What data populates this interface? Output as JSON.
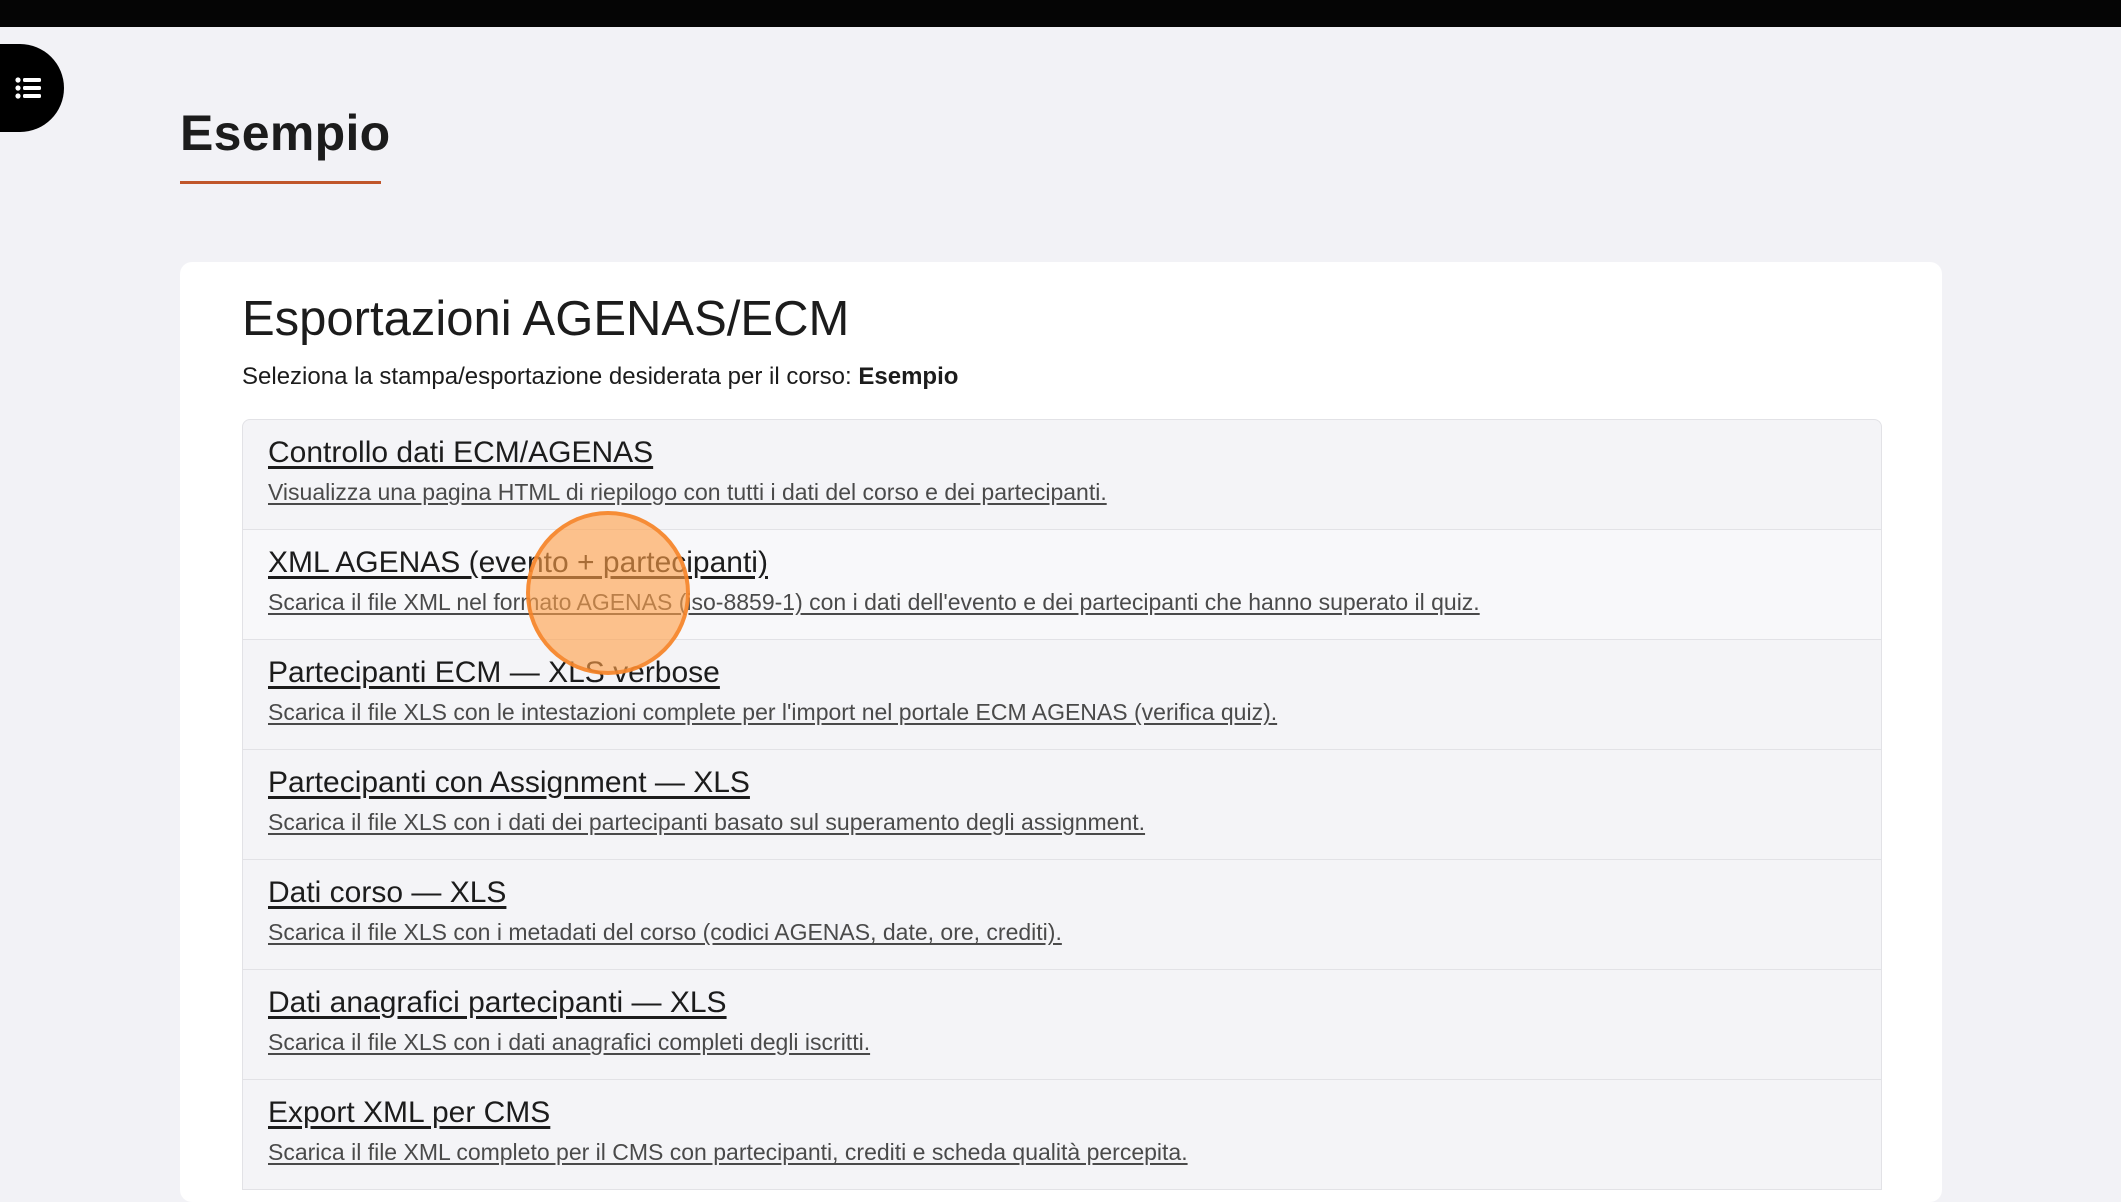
{
  "page": {
    "title": "Esempio"
  },
  "colors": {
    "accent_underline": "#c0562b",
    "cursor_highlight": "#ff9f48"
  },
  "menu_button": {
    "icon": "list-icon"
  },
  "card": {
    "title": "Esportazioni AGENAS/ECM",
    "subtitle_prefix": "Seleziona la stampa/esportazione desiderata per il corso: ",
    "course_name": "Esempio"
  },
  "exports": [
    {
      "title": "Controllo dati ECM/AGENAS",
      "description": "Visualizza una pagina HTML di riepilogo con tutti i dati del corso e dei partecipanti."
    },
    {
      "title": "XML AGENAS (evento + partecipanti)",
      "description": "Scarica il file XML nel formato AGENAS (iso-8859-1) con i dati dell'evento e dei partecipanti che hanno superato il quiz."
    },
    {
      "title": "Partecipanti ECM — XLS verbose",
      "description": "Scarica il file XLS con le intestazioni complete per l'import nel portale ECM AGENAS (verifica quiz)."
    },
    {
      "title": "Partecipanti con Assignment — XLS",
      "description": "Scarica il file XLS con i dati dei partecipanti basato sul superamento degli assignment."
    },
    {
      "title": "Dati corso — XLS",
      "description": "Scarica il file XLS con i metadati del corso (codici AGENAS, date, ore, crediti)."
    },
    {
      "title": "Dati anagrafici partecipanti — XLS",
      "description": "Scarica il file XLS con i dati anagrafici completi degli iscritti."
    },
    {
      "title": "Export XML per CMS",
      "description": "Scarica il file XML completo per il CMS con partecipanti, crediti e scheda qualità percepita."
    }
  ]
}
